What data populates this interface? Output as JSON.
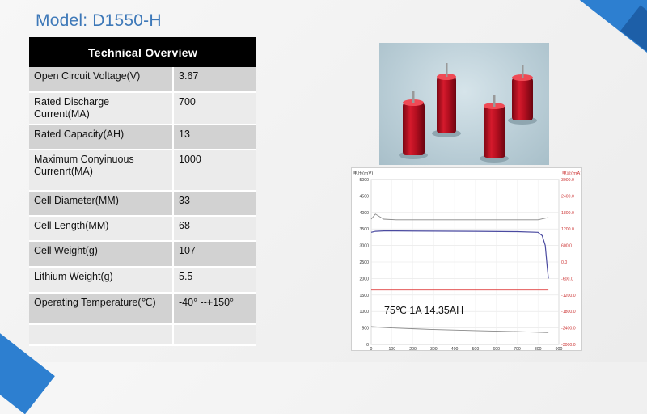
{
  "slide": {
    "title": "Model: D1550-H"
  },
  "table": {
    "header": "Technical  Overview",
    "rows": [
      {
        "label": "Open Circuit Voltage(V)",
        "value": "3.67"
      },
      {
        "label": "Rated Discharge Current(MA)",
        "value": "700"
      },
      {
        "label": "Rated Capacity(AH)",
        "value": "13"
      },
      {
        "label": "Maximum Conyinuous Currenrt(MA)",
        "value": "1000"
      },
      {
        "label": "Cell Diameter(MM)",
        "value": "33"
      },
      {
        "label": "Cell Length(MM)",
        "value": "68"
      },
      {
        "label": "Cell Weight(g)",
        "value": "107"
      },
      {
        "label": "Lithium Weight(g)",
        "value": "5.5"
      },
      {
        "label": "Operating Temperature(℃)",
        "value": "-40° --+150°"
      },
      {
        "label": "",
        "value": ""
      }
    ]
  },
  "photo": {
    "icon": "battery-cells-photo"
  },
  "chart": {
    "left_axis_title": "电压(mV)",
    "right_axis_title": "电流(mA)",
    "annotation": "75℃    1A    14.35AH",
    "colors": {
      "voltage": "#4a4aa0",
      "current": "#e04040",
      "temperature": "#888888"
    }
  },
  "chart_data": {
    "type": "line",
    "xlim": [
      0,
      900
    ],
    "ylim": [
      0,
      5000
    ],
    "y2lim": [
      -3000,
      3000
    ],
    "x_ticks": [
      "0",
      "100",
      "200",
      "300",
      "400",
      "500",
      "600",
      "700",
      "800",
      "900"
    ],
    "y_ticks": [
      "0",
      "500",
      "1000",
      "1500",
      "2000",
      "2500",
      "3000",
      "3500",
      "4000",
      "4500",
      "5000"
    ],
    "y2_ticks": [
      "-3000.0",
      "-2400.0",
      "-1800.0",
      "-1200.0",
      "-600.0",
      "0.0",
      "600.0",
      "1200.0",
      "1800.0",
      "2400.0",
      "3000.0"
    ],
    "series": [
      {
        "x": [
          0,
          20,
          60,
          120,
          300,
          500,
          700,
          800,
          850
        ],
        "y": [
          3800,
          3950,
          3800,
          3780,
          3780,
          3780,
          3780,
          3780,
          3850
        ]
      },
      {
        "x": [
          0,
          20,
          60,
          120,
          300,
          500,
          700,
          800,
          820,
          835,
          845,
          850
        ],
        "y": [
          3400,
          3430,
          3440,
          3440,
          3435,
          3430,
          3420,
          3400,
          3300,
          3000,
          2300,
          2000
        ]
      },
      {
        "x": [
          0,
          850
        ],
        "y": [
          1650,
          1650
        ]
      },
      {
        "x": [
          0,
          100,
          300,
          500,
          700,
          850
        ],
        "y": [
          540,
          500,
          450,
          420,
          390,
          360
        ]
      }
    ]
  }
}
